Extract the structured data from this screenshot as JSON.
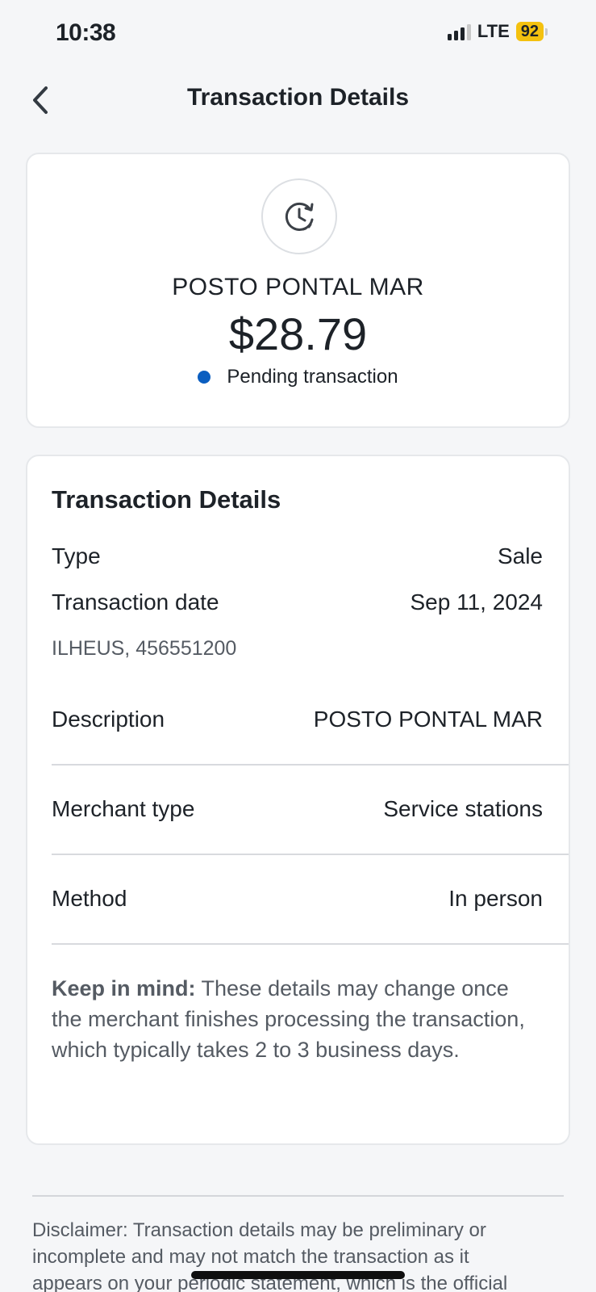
{
  "status_bar": {
    "time": "10:38",
    "network": "LTE",
    "battery": "92"
  },
  "header": {
    "title": "Transaction Details",
    "back_icon": "chevron-left-icon"
  },
  "summary": {
    "status_icon": "clock-refresh-icon",
    "merchant": "POSTO PONTAL MAR",
    "amount": "$28.79",
    "status_text": "Pending transaction",
    "status_color": "#0b5ec0"
  },
  "details": {
    "heading": "Transaction Details",
    "type_label": "Type",
    "type_value": "Sale",
    "date_label": "Transaction date",
    "date_value": "Sep 11, 2024",
    "location": "ILHEUS, 456551200",
    "description_label": "Description",
    "description_value": "POSTO PONTAL MAR",
    "merchant_type_label": "Merchant type",
    "merchant_type_value": "Service stations",
    "method_label": "Method",
    "method_value": "In person",
    "note_bold": "Keep in mind:",
    "note_text": " These details may change once the merchant finishes processing the transaction, which typically takes 2 to 3 business days."
  },
  "footer": {
    "disclaimer": "Disclaimer: Transaction details may be preliminary or incomplete and may not match the transaction as it appears on your periodic statement, which is the official"
  }
}
